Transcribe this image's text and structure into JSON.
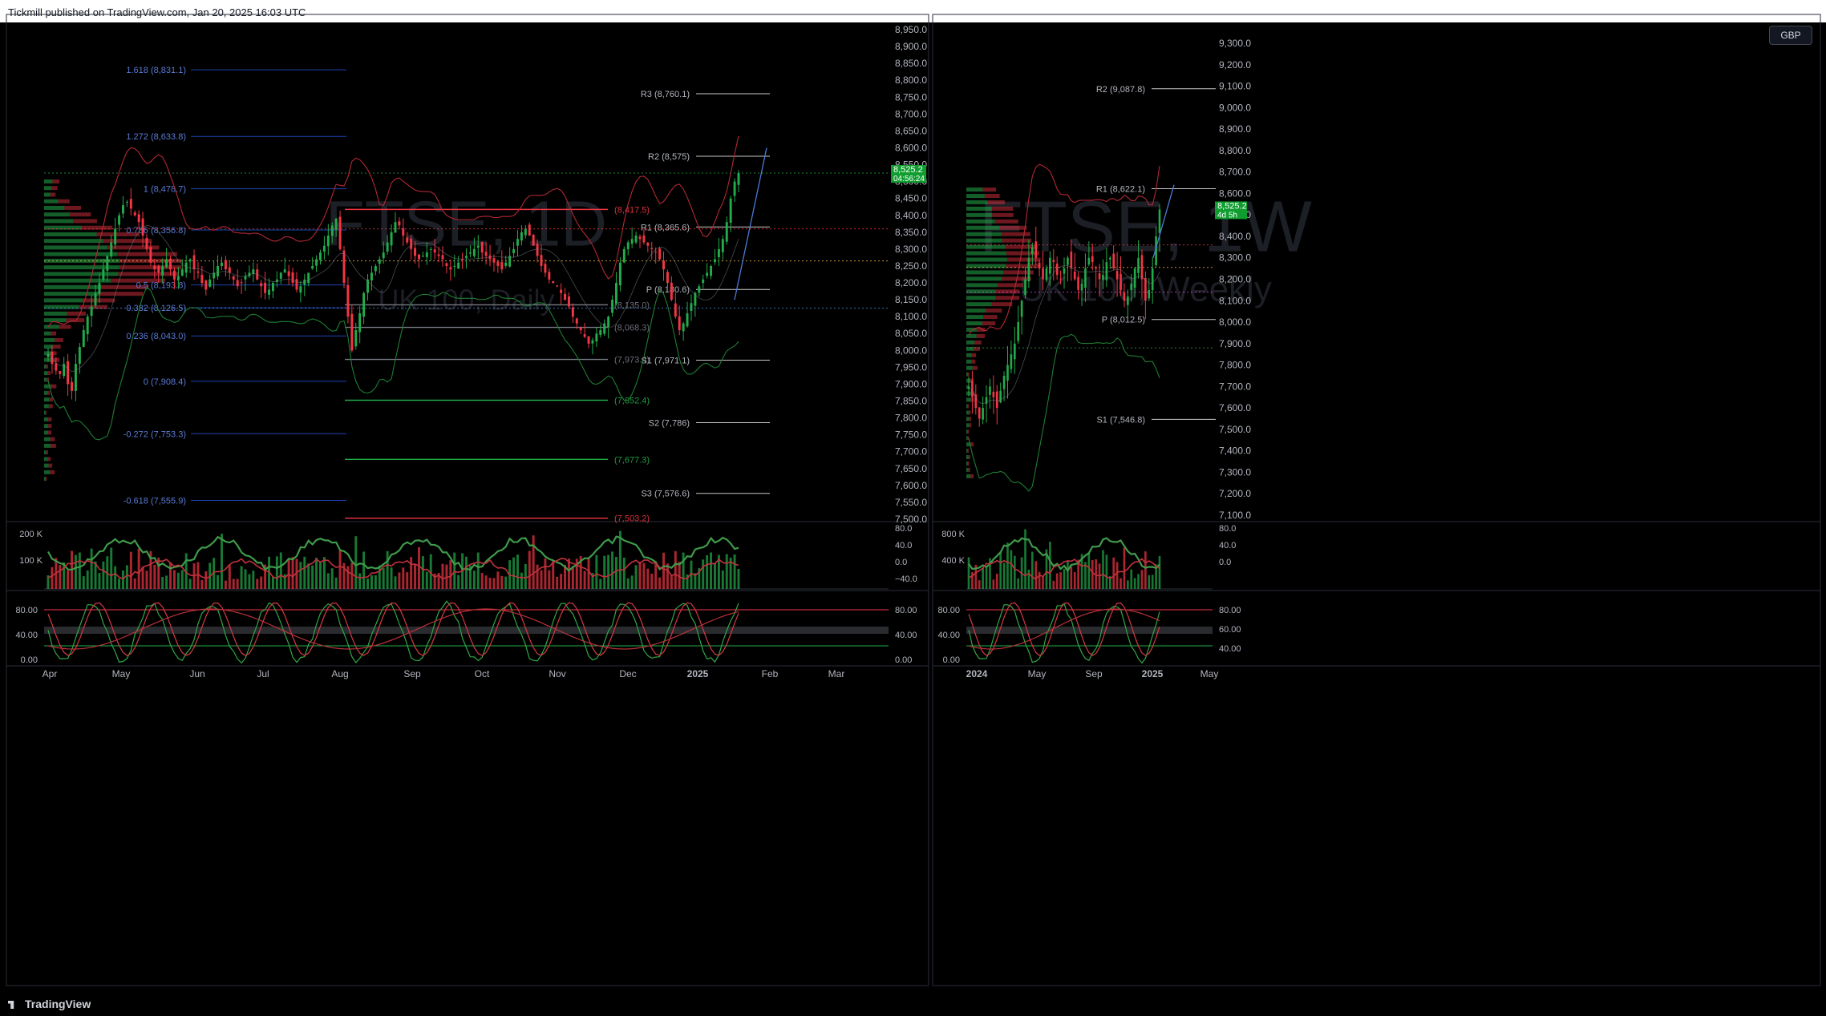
{
  "header": {
    "publisher_text": "Tickmill published on TradingView.com, Jan 20, 2025 16:03 UTC"
  },
  "footer": {
    "brand": "TradingView"
  },
  "colors": {
    "background": "#000000",
    "up": "#22ab4a",
    "down": "#f23645",
    "price_tag": "#0f9d2f",
    "fib": "#2962ff",
    "pivot": "#c8c8c8"
  },
  "icons": {
    "currency_button": "GBP"
  },
  "chart_data": [
    {
      "type": "candlestick",
      "panel": "left",
      "symbol_watermark": "FTSE, 1D",
      "subtitle_watermark": "UK 100, Daily",
      "ylim": [
        7500,
        8950
      ],
      "y_ticks": [
        "8,950.0",
        "8,900.0",
        "8,850.0",
        "8,800.0",
        "8,750.0",
        "8,700.0",
        "8,650.0",
        "8,600.0",
        "8,550.0",
        "8,500.0",
        "8,450.0",
        "8,400.0",
        "8,350.0",
        "8,300.0",
        "8,250.0",
        "8,200.0",
        "8,150.0",
        "8,100.0",
        "8,050.0",
        "8,000.0",
        "7,950.0",
        "7,900.0",
        "7,850.0",
        "7,800.0",
        "7,750.0",
        "7,700.0",
        "7,650.0",
        "7,600.0",
        "7,550.0",
        "7,500.0"
      ],
      "x_ticks": [
        "Apr",
        "May",
        "Jun",
        "Jul",
        "Aug",
        "Sep",
        "Oct",
        "Nov",
        "Dec",
        "2025",
        "Feb",
        "Mar"
      ],
      "last_price": {
        "value": 8525.2,
        "label": "8,525.2",
        "countdown": "04:56:24"
      },
      "fib_levels": [
        {
          "label": "1.618 (8,831.1)",
          "value": 8831.1
        },
        {
          "label": "1.272 (8,633.8)",
          "value": 8633.8
        },
        {
          "label": "1 (8,478.7)",
          "value": 8478.7
        },
        {
          "label": "0.786 (8,356.8)",
          "value": 8356.8
        },
        {
          "label": "0.5 (8,193.8)",
          "value": 8193.8
        },
        {
          "label": "0.382 (8,126.5)",
          "value": 8126.5
        },
        {
          "label": "0.236 (8,043.0)",
          "value": 8043.0
        },
        {
          "label": "0 (7,908.4)",
          "value": 7908.4
        },
        {
          "label": "-0.272 (7,753.3)",
          "value": 7753.3
        },
        {
          "label": "-0.618 (7,555.9)",
          "value": 7555.9
        }
      ],
      "horizontal_levels": [
        {
          "label": "(8,417.5)",
          "value": 8417.5,
          "color": "#f23645"
        },
        {
          "label": "(8,135.0)",
          "value": 8135.0,
          "color": "#787b86"
        },
        {
          "label": "(8,068.3)",
          "value": 8068.3,
          "color": "#787b86"
        },
        {
          "label": "(7,973.4)",
          "value": 7973.4,
          "color": "#787b86"
        },
        {
          "label": "(7,852.4)",
          "value": 7852.4,
          "color": "#22ab4a"
        },
        {
          "label": "(7,677.3)",
          "value": 7677.3,
          "color": "#22ab4a"
        },
        {
          "label": "(7,503.2)",
          "value": 7503.2,
          "color": "#f23645"
        }
      ],
      "pivots": [
        {
          "label": "R3 (8,760.1)",
          "value": 8760.1
        },
        {
          "label": "R2 (8,575)",
          "value": 8575
        },
        {
          "label": "R1 (8,365.6)",
          "value": 8365.6
        },
        {
          "label": "P (8,180.6)",
          "value": 8180.6
        },
        {
          "label": "S1 (7,971.1)",
          "value": 7971.1
        },
        {
          "label": "S2 (7,786)",
          "value": 7786
        },
        {
          "label": "S3 (7,576.6)",
          "value": 7576.6
        }
      ],
      "close_series": [
        7990,
        7960,
        7940,
        7930,
        7960,
        7900,
        7880,
        7960,
        8010,
        8060,
        8100,
        8130,
        8170,
        8200,
        8240,
        8280,
        8320,
        8360,
        8400,
        8430,
        8440,
        8420,
        8400,
        8380,
        8340,
        8300,
        8260,
        8240,
        8230,
        8250,
        8270,
        8240,
        8210,
        8220,
        8240,
        8260,
        8270,
        8240,
        8230,
        8200,
        8180,
        8210,
        8230,
        8250,
        8260,
        8240,
        8230,
        8210,
        8190,
        8200,
        8220,
        8230,
        8240,
        8210,
        8190,
        8170,
        8180,
        8200,
        8210,
        8230,
        8240,
        8220,
        8200,
        8180,
        8190,
        8210,
        8230,
        8250,
        8270,
        8290,
        8310,
        8340,
        8370,
        8390,
        8300,
        8200,
        8100,
        8000,
        8060,
        8110,
        8170,
        8210,
        8230,
        8250,
        8270,
        8290,
        8320,
        8350,
        8380,
        8370,
        8340,
        8320,
        8300,
        8280,
        8270,
        8280,
        8290,
        8300,
        8290,
        8280,
        8270,
        8250,
        8240,
        8250,
        8260,
        8270,
        8280,
        8290,
        8300,
        8310,
        8290,
        8280,
        8270,
        8260,
        8250,
        8240,
        8260,
        8280,
        8300,
        8330,
        8350,
        8360,
        8340,
        8310,
        8280,
        8250,
        8230,
        8210,
        8200,
        8190,
        8170,
        8150,
        8130,
        8100,
        8080,
        8060,
        8040,
        8020,
        8030,
        8050,
        8060,
        8080,
        8100,
        8150,
        8200,
        8260,
        8300,
        8320,
        8330,
        8340,
        8330,
        8320,
        8310,
        8300,
        8290,
        8270,
        8240,
        8200,
        8150,
        8100,
        8060,
        8080,
        8110,
        8140,
        8170,
        8190,
        8210,
        8230,
        8250,
        8270,
        8300,
        8330,
        8380,
        8450,
        8500,
        8525.2
      ],
      "volume_axis": [
        "200 K",
        "100 K"
      ],
      "volume_osc_axis": [
        "80.0",
        "40.0",
        "0.0",
        "−40.0"
      ],
      "stoch_axis": [
        "80.00",
        "40.00",
        "0.00"
      ],
      "stoch_axis_right": [
        "80.00",
        "40.00",
        "0.00"
      ]
    },
    {
      "type": "candlestick",
      "panel": "right",
      "symbol_watermark": "FTSE, 1W",
      "subtitle_watermark": "UK 100, Weekly",
      "ylim": [
        7100,
        9300
      ],
      "y_ticks": [
        "9,300.0",
        "9,200.0",
        "9,100.0",
        "9,000.0",
        "8,900.0",
        "8,800.0",
        "8,700.0",
        "8,600.0",
        "8,500.0",
        "8,400.0",
        "8,300.0",
        "8,200.0",
        "8,100.0",
        "8,000.0",
        "7,900.0",
        "7,800.0",
        "7,700.0",
        "7,600.0",
        "7,500.0",
        "7,400.0",
        "7,300.0",
        "7,200.0",
        "7,100.0"
      ],
      "x_ticks": [
        "2024",
        "May",
        "Sep",
        "2025",
        "May"
      ],
      "last_price": {
        "value": 8525.2,
        "label": "8,525.2",
        "countdown": "4d 5h"
      },
      "pivots": [
        {
          "label": "R2 (9,087.8)",
          "value": 9087.8
        },
        {
          "label": "R1 (8,622.1)",
          "value": 8622.1
        },
        {
          "label": "P (8,012.5)",
          "value": 8012.5
        },
        {
          "label": "S1 (7,546.8)",
          "value": 7546.8
        }
      ],
      "close_series": [
        7700,
        7650,
        7600,
        7550,
        7600,
        7650,
        7700,
        7650,
        7600,
        7680,
        7750,
        7800,
        7850,
        7900,
        8000,
        8100,
        8200,
        8300,
        8350,
        8300,
        8250,
        8200,
        8250,
        8300,
        8280,
        8220,
        8200,
        8250,
        8300,
        8250,
        8200,
        8150,
        8180,
        8250,
        8300,
        8280,
        8250,
        8200,
        8220,
        8280,
        8300,
        8250,
        8200,
        8150,
        8100,
        8120,
        8180,
        8250,
        8300,
        8200,
        8100,
        8150,
        8250,
        8400,
        8525.2
      ],
      "volume_axis": [
        "800 K",
        "400 K"
      ],
      "volume_osc_axis": [
        "80.0",
        "40.0",
        "0.0"
      ],
      "stoch_axis": [
        "80.00",
        "40.00",
        "0.00"
      ],
      "stoch_axis_right": [
        "80.00",
        "60.00",
        "40.00"
      ]
    }
  ]
}
